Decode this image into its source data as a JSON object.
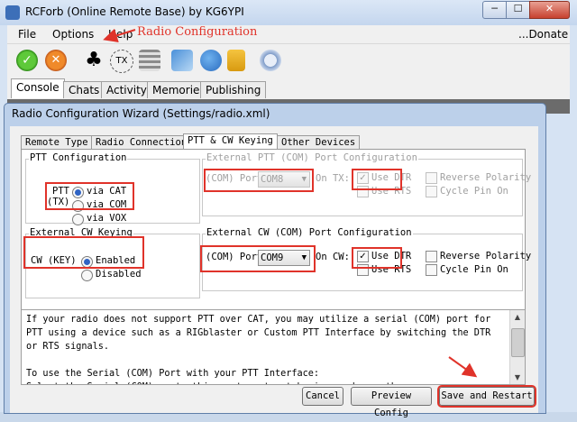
{
  "window": {
    "title": "RCForb (Online Remote Base) by KG6YPI",
    "min_label": "─",
    "max_label": "☐",
    "close_label": "✕"
  },
  "menu": {
    "file": "File",
    "options": "Options",
    "help": "Help",
    "donate": "...Donate"
  },
  "annotation": {
    "radio_config": "Radio Configuration",
    "color": "#e0332a"
  },
  "toolbar": {
    "icons": [
      "checkmark-icon",
      "stop-icon",
      "club-icon",
      "tx-icon",
      "list-icon",
      "computers-icon",
      "users-icon",
      "lock-icon",
      "settings-icon"
    ]
  },
  "main_tabs": [
    "Console",
    "Chats",
    "Activity",
    "Memories",
    "Publishing"
  ],
  "dialog": {
    "title": "Radio Configuration Wizard (Settings/radio.xml)",
    "tabs": [
      "Remote Type",
      "Radio Connection",
      "PTT & CW Keying",
      "Other Devices"
    ],
    "active_tab": "PTT & CW Keying",
    "ptt": {
      "group_label": "PTT Configuration",
      "ptt_label": "PTT",
      "tx_label": "(TX)",
      "options": [
        "via CAT",
        "via COM",
        "via VOX"
      ],
      "selected": "via CAT"
    },
    "ext_ptt": {
      "group_label": "External PTT (COM) Port Configuration",
      "com_label": "(COM) Port",
      "com_value": "COM8",
      "on_tx_label": "On TX:",
      "use_dtr": "Use DTR",
      "use_rts": "Use RTS",
      "reverse": "Reverse Polarity",
      "cycle": "Cycle Pin On"
    },
    "cw": {
      "group_label": "External CW Keying",
      "key_label": "CW (KEY)",
      "enabled": "Enabled",
      "disabled": "Disabled",
      "selected": "Enabled"
    },
    "ext_cw": {
      "group_label": "External CW (COM) Port Configuration",
      "com_label": "(COM) Port",
      "com_value": "COM9",
      "on_cw_label": "On CW:",
      "use_dtr": "Use DTR",
      "use_rts": "Use RTS",
      "reverse": "Reverse Polarity",
      "cycle": "Cycle Pin On"
    },
    "info_text": "If your radio does not support PTT over CAT, you may utilize a serial (COM) port for PTT using a device such as a RIGblaster or Custom PTT Interface by switching the DTR or RTS signals.\n\nTo use the Serial (COM) Port with your PTT Interface:\nSelect the Serial (COM) port, this port must not be in use by another program.\nSelect the pins to signal (DTR, RTS or DTR and RTS) for activating PTT.\nIf ... please ... the ... of ... signal.",
    "buttons": {
      "cancel": "Cancel",
      "preview": "Preview Config",
      "save": "Save and Restart"
    }
  }
}
